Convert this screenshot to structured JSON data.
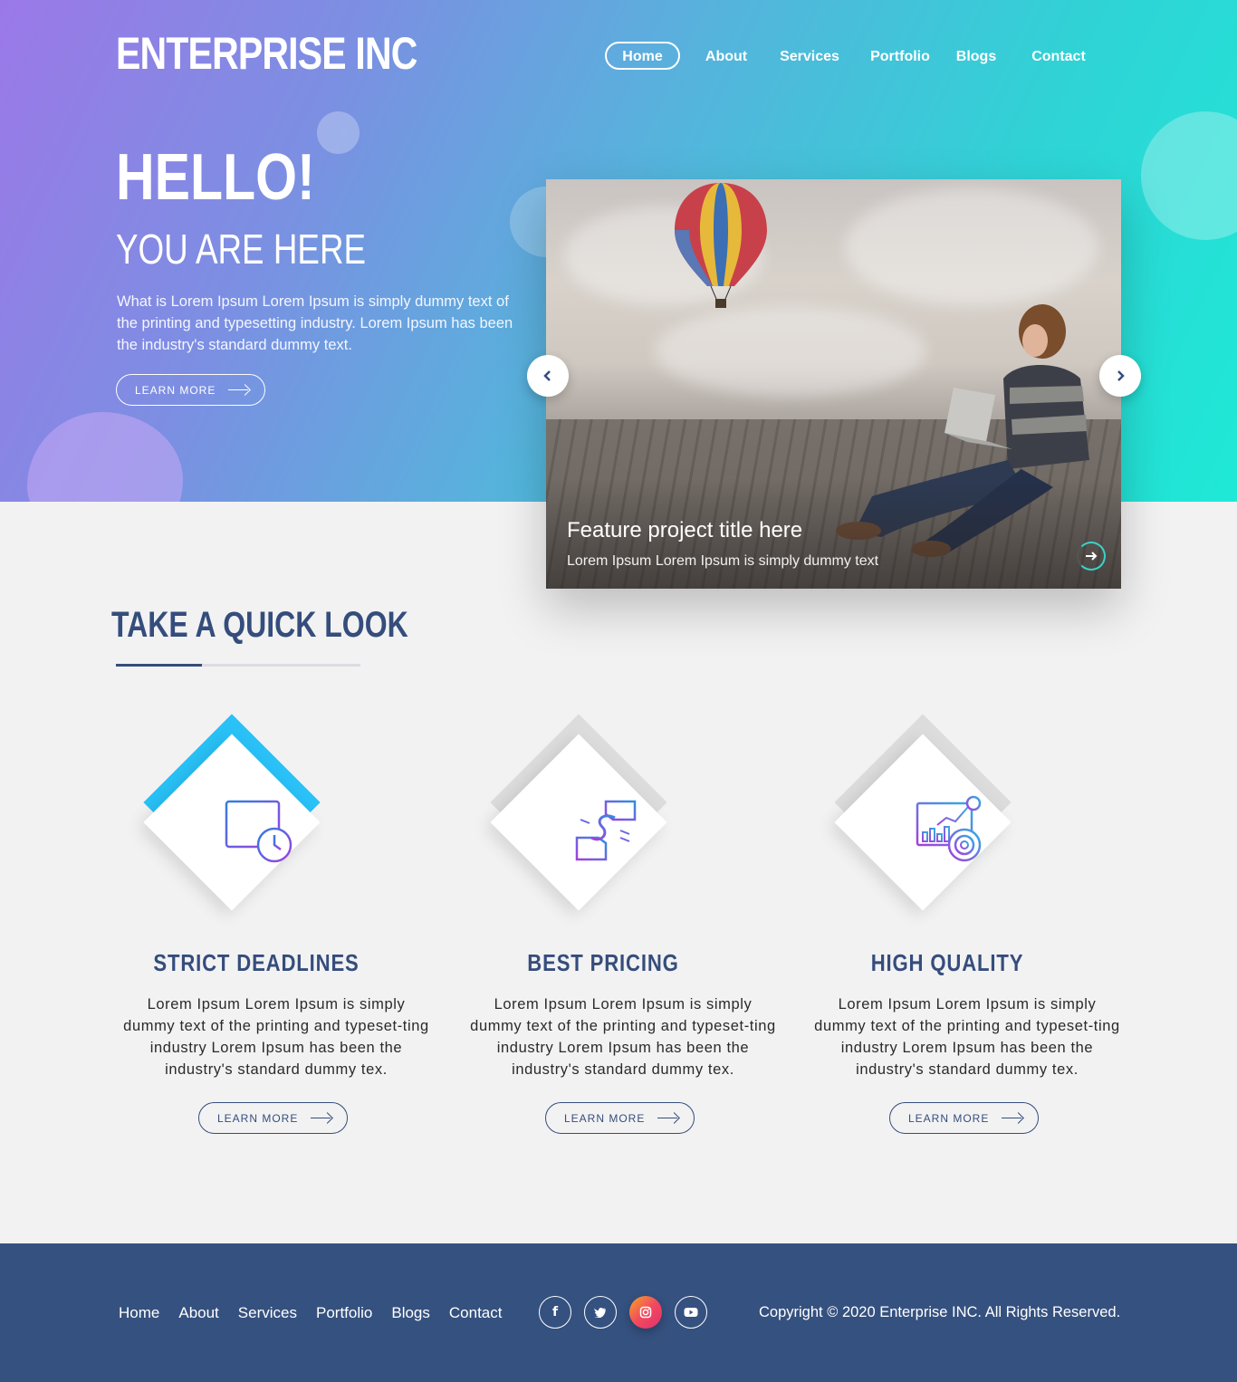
{
  "brand": {
    "name": "ENTERPRISE INC"
  },
  "nav": {
    "items": [
      "Home",
      "About",
      "Services",
      "Portfolio",
      "Blogs",
      "Contact"
    ],
    "active": "Home"
  },
  "hero": {
    "greeting": "HELLO!",
    "subtitle": "YOU ARE HERE",
    "text": "What is Lorem Ipsum Lorem Ipsum is simply dummy text of the printing and typesetting industry. Lorem Ipsum has been the industry's standard dummy text.",
    "button": "LEARN MORE"
  },
  "slider": {
    "title": "Feature project title here",
    "subtitle": "Lorem Ipsum Lorem Ipsum is simply dummy text",
    "prev_icon": "chevron-left-icon",
    "next_icon": "chevron-right-icon"
  },
  "quick_look": {
    "title": "TAKE A QUICK LOOK",
    "features": [
      {
        "title": "STRICT DEADLINES",
        "icon": "calendar-clock-icon",
        "accent": "#29c1f6",
        "text": "Lorem Ipsum Lorem Ipsum is simply dummy text of the printing and typeset-ting industry Lorem Ipsum has been the industry's standard dummy tex.",
        "button": "LEARN MORE"
      },
      {
        "title": "BEST PRICING",
        "icon": "dollar-handshake-icon",
        "accent": "#dddddd",
        "text": "Lorem Ipsum Lorem Ipsum is simply dummy text of the printing and typeset-ting industry Lorem Ipsum has been the industry's standard dummy tex.",
        "button": "LEARN MORE"
      },
      {
        "title": "HIGH QUALITY",
        "icon": "analytics-chart-icon",
        "accent": "#dddddd",
        "text": "Lorem Ipsum Lorem Ipsum is simply dummy text of the printing and typeset-ting industry Lorem Ipsum has been the industry's standard dummy tex.",
        "button": "LEARN MORE"
      }
    ]
  },
  "footer": {
    "nav": [
      "Home",
      "About",
      "Services",
      "Portfolio",
      "Blogs",
      "Contact"
    ],
    "social": [
      "facebook-icon",
      "twitter-icon",
      "instagram-icon",
      "youtube-icon"
    ],
    "copyright": "Copyright © 2020 Enterprise INC. All Rights Reserved."
  },
  "colors": {
    "primary_navy": "#354d7c",
    "hero_gradient_start": "#9b78e8",
    "hero_gradient_end": "#1ee9d6",
    "accent_cyan": "#29c1f6"
  }
}
